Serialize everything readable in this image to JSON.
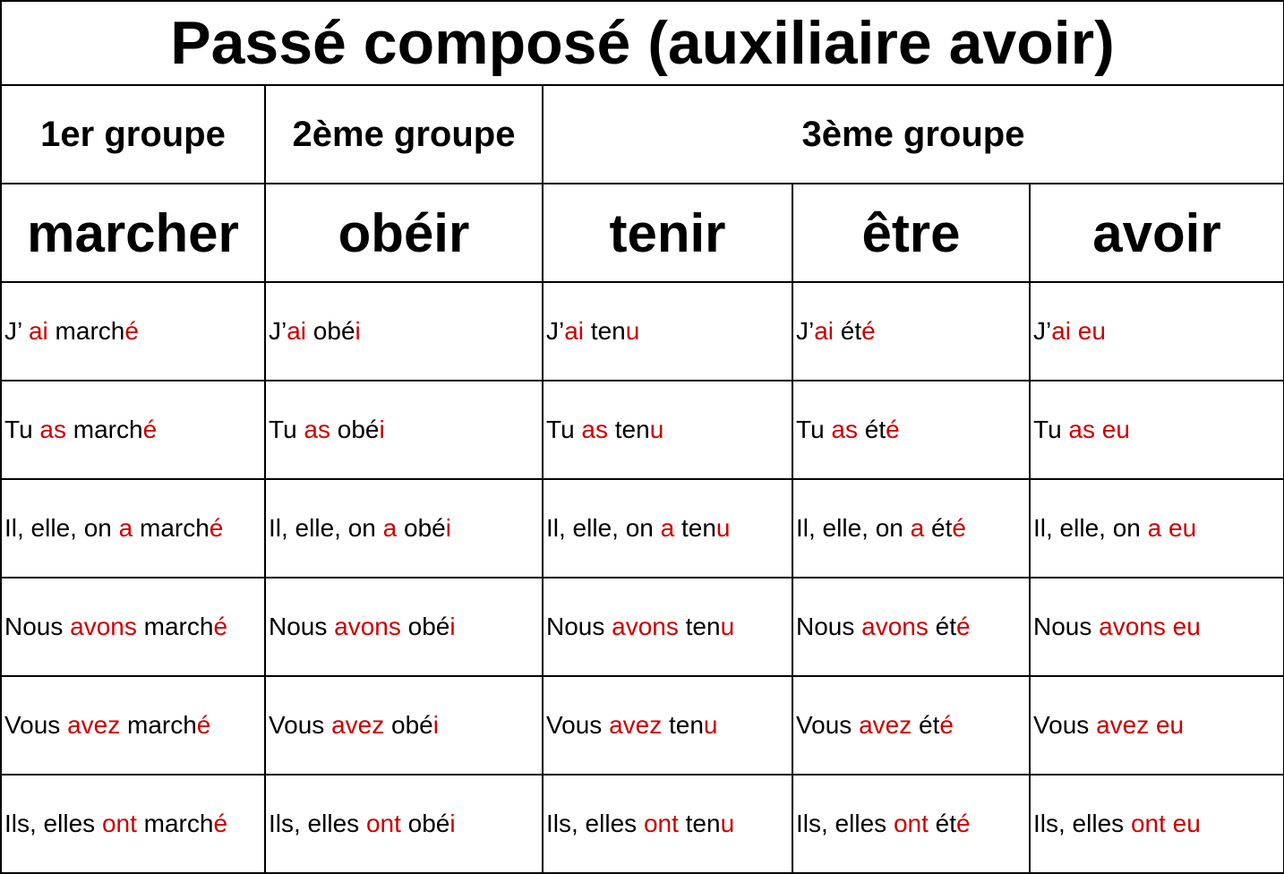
{
  "title": "Passé composé (auxiliaire avoir)",
  "groups": [
    {
      "label": "1er groupe",
      "span": 1
    },
    {
      "label": "2ème groupe",
      "span": 1
    },
    {
      "label": "3ème groupe",
      "span": 3
    }
  ],
  "verbs": [
    "marcher",
    "obéir",
    "tenir",
    "être",
    "avoir"
  ],
  "highlight_color": "#cc0000",
  "rows": [
    [
      [
        {
          "t": "J’ ",
          "r": false
        },
        {
          "t": "ai",
          "r": true
        },
        {
          "t": " march",
          "r": false
        },
        {
          "t": "é",
          "r": true
        }
      ],
      [
        {
          "t": "J’",
          "r": false
        },
        {
          "t": "ai",
          "r": true
        },
        {
          "t": " obé",
          "r": false
        },
        {
          "t": "i",
          "r": true
        }
      ],
      [
        {
          "t": "J’",
          "r": false
        },
        {
          "t": "ai",
          "r": true
        },
        {
          "t": " ten",
          "r": false
        },
        {
          "t": "u",
          "r": true
        }
      ],
      [
        {
          "t": "J’",
          "r": false
        },
        {
          "t": "ai",
          "r": true
        },
        {
          "t": " ét",
          "r": false
        },
        {
          "t": "é",
          "r": true
        }
      ],
      [
        {
          "t": "J’",
          "r": false
        },
        {
          "t": "ai eu",
          "r": true
        }
      ]
    ],
    [
      [
        {
          "t": "Tu ",
          "r": false
        },
        {
          "t": "as",
          "r": true
        },
        {
          "t": " march",
          "r": false
        },
        {
          "t": "é",
          "r": true
        }
      ],
      [
        {
          "t": "Tu ",
          "r": false
        },
        {
          "t": "as",
          "r": true
        },
        {
          "t": " obé",
          "r": false
        },
        {
          "t": "i",
          "r": true
        }
      ],
      [
        {
          "t": "Tu ",
          "r": false
        },
        {
          "t": "as",
          "r": true
        },
        {
          "t": " ten",
          "r": false
        },
        {
          "t": "u",
          "r": true
        }
      ],
      [
        {
          "t": "Tu ",
          "r": false
        },
        {
          "t": "as",
          "r": true
        },
        {
          "t": " ét",
          "r": false
        },
        {
          "t": "é",
          "r": true
        }
      ],
      [
        {
          "t": "Tu ",
          "r": false
        },
        {
          "t": "as eu",
          "r": true
        }
      ]
    ],
    [
      [
        {
          "t": "Il, elle, on ",
          "r": false
        },
        {
          "t": "a",
          "r": true
        },
        {
          "t": " march",
          "r": false
        },
        {
          "t": "é",
          "r": true
        }
      ],
      [
        {
          "t": "Il, elle, on ",
          "r": false
        },
        {
          "t": "a",
          "r": true
        },
        {
          "t": " obé",
          "r": false
        },
        {
          "t": "i",
          "r": true
        }
      ],
      [
        {
          "t": "Il, elle, on ",
          "r": false
        },
        {
          "t": "a",
          "r": true
        },
        {
          "t": " ten",
          "r": false
        },
        {
          "t": "u",
          "r": true
        }
      ],
      [
        {
          "t": "Il, elle, on ",
          "r": false
        },
        {
          "t": "a",
          "r": true
        },
        {
          "t": " ét",
          "r": false
        },
        {
          "t": "é",
          "r": true
        }
      ],
      [
        {
          "t": "Il, elle, on ",
          "r": false
        },
        {
          "t": "a eu",
          "r": true
        }
      ]
    ],
    [
      [
        {
          "t": "Nous ",
          "r": false
        },
        {
          "t": "avons",
          "r": true
        },
        {
          "t": " march",
          "r": false
        },
        {
          "t": "é",
          "r": true
        }
      ],
      [
        {
          "t": "Nous ",
          "r": false
        },
        {
          "t": "avons",
          "r": true
        },
        {
          "t": " obé",
          "r": false
        },
        {
          "t": "i",
          "r": true
        }
      ],
      [
        {
          "t": "Nous ",
          "r": false
        },
        {
          "t": "avons",
          "r": true
        },
        {
          "t": " ten",
          "r": false
        },
        {
          "t": "u",
          "r": true
        }
      ],
      [
        {
          "t": "Nous ",
          "r": false
        },
        {
          "t": "avons",
          "r": true
        },
        {
          "t": " ét",
          "r": false
        },
        {
          "t": "é",
          "r": true
        }
      ],
      [
        {
          "t": "Nous ",
          "r": false
        },
        {
          "t": "avons eu",
          "r": true
        }
      ]
    ],
    [
      [
        {
          "t": "Vous ",
          "r": false
        },
        {
          "t": "avez",
          "r": true
        },
        {
          "t": " march",
          "r": false
        },
        {
          "t": "é",
          "r": true
        }
      ],
      [
        {
          "t": "Vous ",
          "r": false
        },
        {
          "t": "avez",
          "r": true
        },
        {
          "t": " obé",
          "r": false
        },
        {
          "t": "i",
          "r": true
        }
      ],
      [
        {
          "t": "Vous ",
          "r": false
        },
        {
          "t": "avez",
          "r": true
        },
        {
          "t": " ten",
          "r": false
        },
        {
          "t": "u",
          "r": true
        }
      ],
      [
        {
          "t": "Vous ",
          "r": false
        },
        {
          "t": "avez",
          "r": true
        },
        {
          "t": " ét",
          "r": false
        },
        {
          "t": "é",
          "r": true
        }
      ],
      [
        {
          "t": "Vous ",
          "r": false
        },
        {
          "t": "avez eu",
          "r": true
        }
      ]
    ],
    [
      [
        {
          "t": "Ils, elles ",
          "r": false
        },
        {
          "t": "ont",
          "r": true
        },
        {
          "t": " march",
          "r": false
        },
        {
          "t": "é",
          "r": true
        }
      ],
      [
        {
          "t": "Ils, elles ",
          "r": false
        },
        {
          "t": "ont",
          "r": true
        },
        {
          "t": " obé",
          "r": false
        },
        {
          "t": "i",
          "r": true
        }
      ],
      [
        {
          "t": "Ils, elles ",
          "r": false
        },
        {
          "t": "ont",
          "r": true
        },
        {
          "t": " ten",
          "r": false
        },
        {
          "t": "u",
          "r": true
        }
      ],
      [
        {
          "t": "Ils, elles ",
          "r": false
        },
        {
          "t": "ont",
          "r": true
        },
        {
          "t": " ét",
          "r": false
        },
        {
          "t": "é",
          "r": true
        }
      ],
      [
        {
          "t": "Ils, elles ",
          "r": false
        },
        {
          "t": "ont eu",
          "r": true
        }
      ]
    ]
  ]
}
